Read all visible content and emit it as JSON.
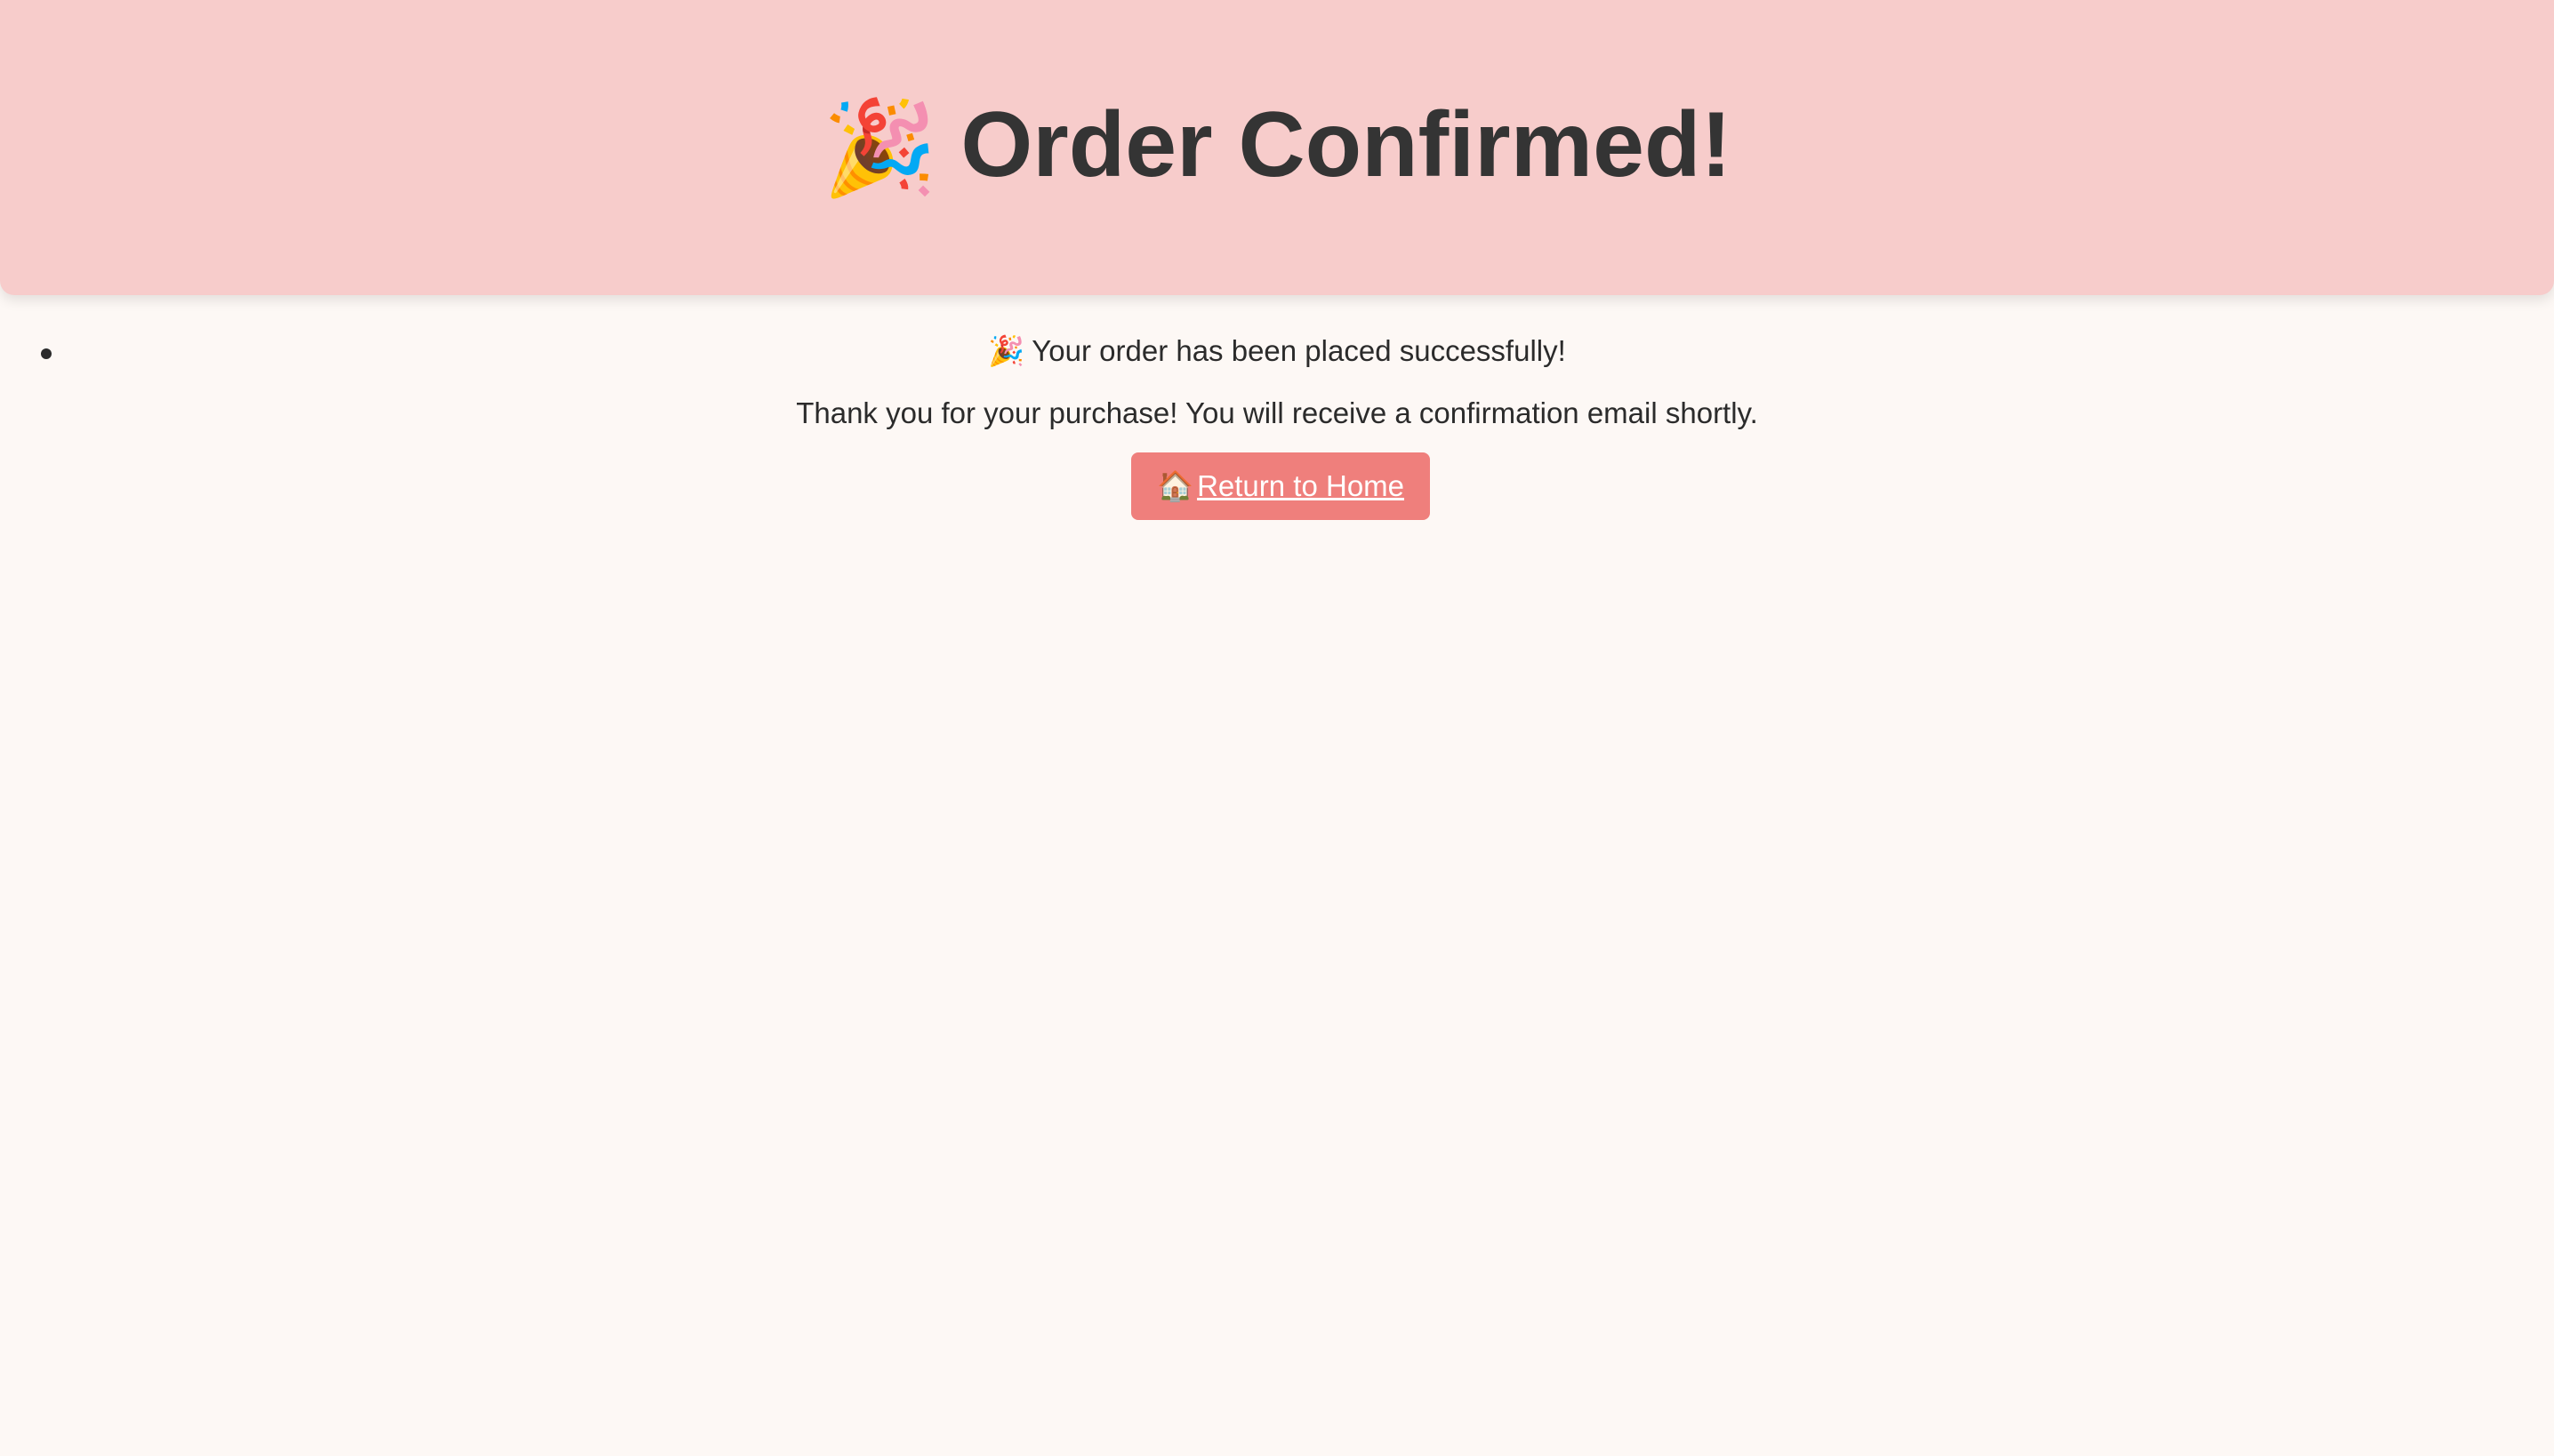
{
  "header": {
    "icon": "party-popper-icon",
    "icon_glyph": "🎉",
    "title": "Order Confirmed!",
    "background_color": "#f7cccb"
  },
  "messages": {
    "success": {
      "icon": "party-popper-icon",
      "icon_glyph": "🎉",
      "text": "Your order has been placed successfully!"
    },
    "thanks": "Thank you for your purchase! You will receive a confirmation email shortly."
  },
  "actions": {
    "home_button": {
      "icon": "house-icon",
      "icon_glyph": "🏠",
      "label": "Return to Home",
      "background_color": "#ef7f7c"
    }
  }
}
